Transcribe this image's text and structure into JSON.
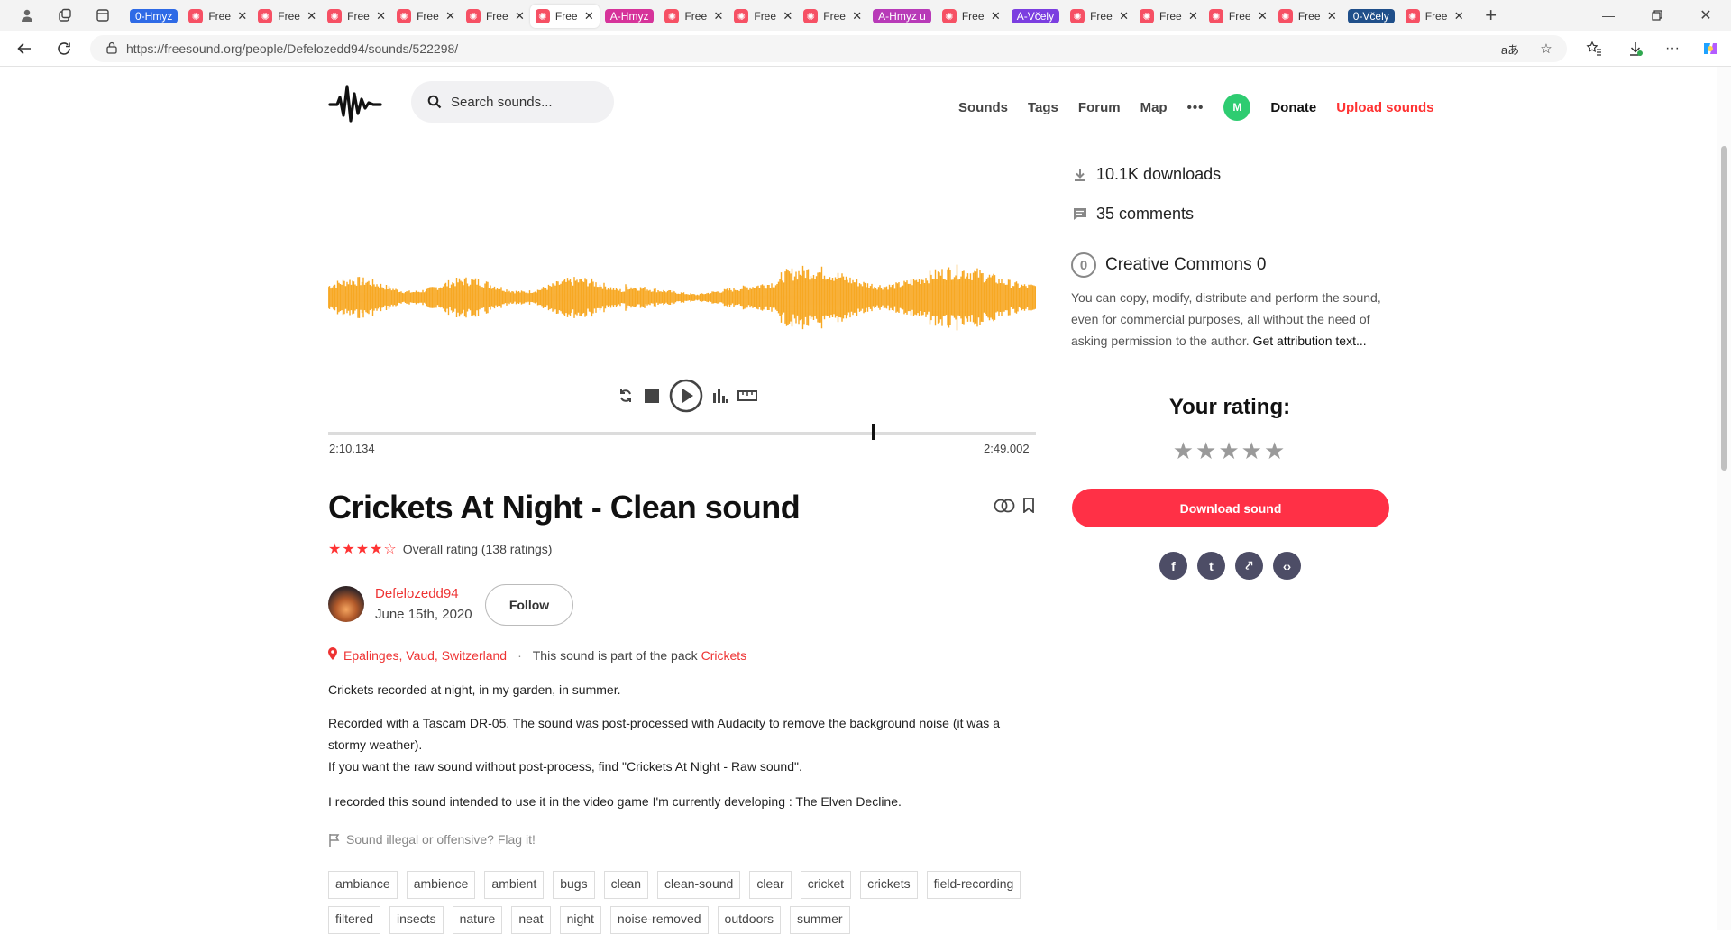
{
  "browser": {
    "tabs": [
      {
        "group_label": "0-Hmyz",
        "group_color": "#2e6ae6"
      },
      {
        "title": "Free"
      },
      {
        "title": "Free"
      },
      {
        "title": "Free"
      },
      {
        "title": "Free"
      },
      {
        "title": "Free"
      },
      {
        "title": "Free",
        "active": true
      },
      {
        "group_label": "A-Hmyz",
        "group_color": "#d6339a"
      },
      {
        "title": "Free"
      },
      {
        "title": "Free"
      },
      {
        "title": "Free"
      },
      {
        "group_label": "A-Hmyz u",
        "group_color": "#b83ab8"
      },
      {
        "title": "Free"
      },
      {
        "group_label": "A-Včely",
        "group_color": "#7b3ee0"
      },
      {
        "title": "Free"
      },
      {
        "title": "Free"
      },
      {
        "title": "Free"
      },
      {
        "title": "Free"
      },
      {
        "group_label": "0-Včely",
        "group_color": "#1f4f8a"
      },
      {
        "title": "Free"
      }
    ],
    "url": "https://freesound.org/people/Defelozedd94/sounds/522298/"
  },
  "header": {
    "search_placeholder": "Search sounds...",
    "nav": [
      "Sounds",
      "Tags",
      "Forum",
      "Map"
    ],
    "more": "•••",
    "avatar_letter": "M",
    "donate": "Donate",
    "upload": "Upload sounds"
  },
  "player": {
    "current_time": "2:10.134",
    "total_time": "2:49.002",
    "progress_fraction": 0.769,
    "waveform_color": "#f7a823"
  },
  "sound": {
    "title": "Crickets At Night - Clean sound",
    "rating_stars": "★★★★☆",
    "rating_text": "Overall rating (138 ratings)",
    "user": "Defelozedd94",
    "date": "June 15th, 2020",
    "follow": "Follow",
    "location": "Epalinges, Vaud, Switzerland",
    "pack_prefix": "This sound is part of the pack",
    "pack": "Crickets",
    "description": [
      "Crickets recorded at night, in my garden, in summer.",
      "Recorded with a Tascam DR-05. The sound was post-processed with Audacity to remove the background noise (it was a stormy weather).",
      "If you want the raw sound without post-process, find \"Crickets At Night - Raw sound\".",
      "I recorded this sound intended to use it in the video game I'm currently developing : The Elven Decline."
    ],
    "flag": "Sound illegal or offensive? Flag it!",
    "tags": [
      "ambiance",
      "ambience",
      "ambient",
      "bugs",
      "clean",
      "clean-sound",
      "clear",
      "cricket",
      "crickets",
      "field-recording",
      "filtered",
      "insects",
      "nature",
      "neat",
      "night",
      "noise-removed",
      "outdoors",
      "summer"
    ]
  },
  "sidebar": {
    "downloads": "10.1K downloads",
    "comments": "35 comments",
    "license_title": "Creative Commons 0",
    "license_icon": "0",
    "license_desc": "You can copy, modify, distribute and perform the sound, even for commercial purposes, all without the need of asking permission to the author.",
    "license_attr": "Get attribution text...",
    "your_rating": "Your rating:",
    "rate_stars": "★★★★★",
    "download": "Download sound",
    "share": [
      {
        "icon": "facebook-icon",
        "glyph": "f"
      },
      {
        "icon": "twitter-icon",
        "glyph": "t"
      },
      {
        "icon": "share-icon",
        "glyph": "⤤"
      },
      {
        "icon": "embed-icon",
        "glyph": "‹›"
      }
    ]
  }
}
